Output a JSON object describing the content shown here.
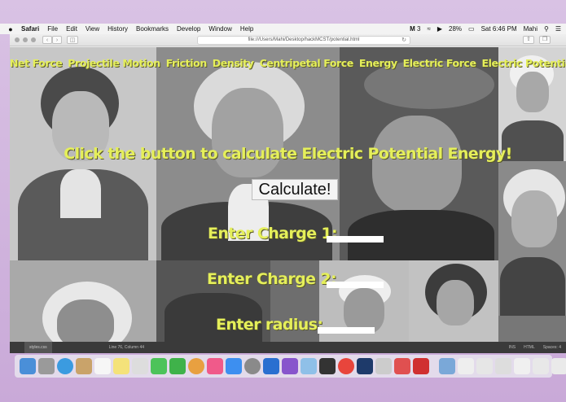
{
  "menubar": {
    "app": "Safari",
    "items": [
      "File",
      "Edit",
      "View",
      "History",
      "Bookmarks",
      "Develop",
      "Window",
      "Help"
    ],
    "status": {
      "badge": "3",
      "battery": "28%",
      "clock": "Sat 6:46 PM",
      "user": "Mahi"
    }
  },
  "browser": {
    "url": "file:///Users/Mahi/Desktop/hackMCST/potential.html"
  },
  "page": {
    "nav": [
      "Net Force",
      "Projectile Motion",
      "Friction",
      "Density",
      "Centripetal Force",
      "Energy",
      "Electric Force",
      "Electric Potential Energy"
    ],
    "heading": "Click the button to calculate Electric Potential Energy!",
    "button": "Calculate!",
    "fields": {
      "charge1": "Enter Charge 1:",
      "charge2": "Enter Charge 2:",
      "radius": "Enter radius:"
    },
    "colors": {
      "text": "#e5ef5a",
      "background": "#6e6e6e"
    }
  },
  "editor": {
    "tab": "styles.css",
    "position": "Line 76, Column 44",
    "mode": "INS",
    "lang": "HTML",
    "spaces": "Spaces: 4"
  }
}
